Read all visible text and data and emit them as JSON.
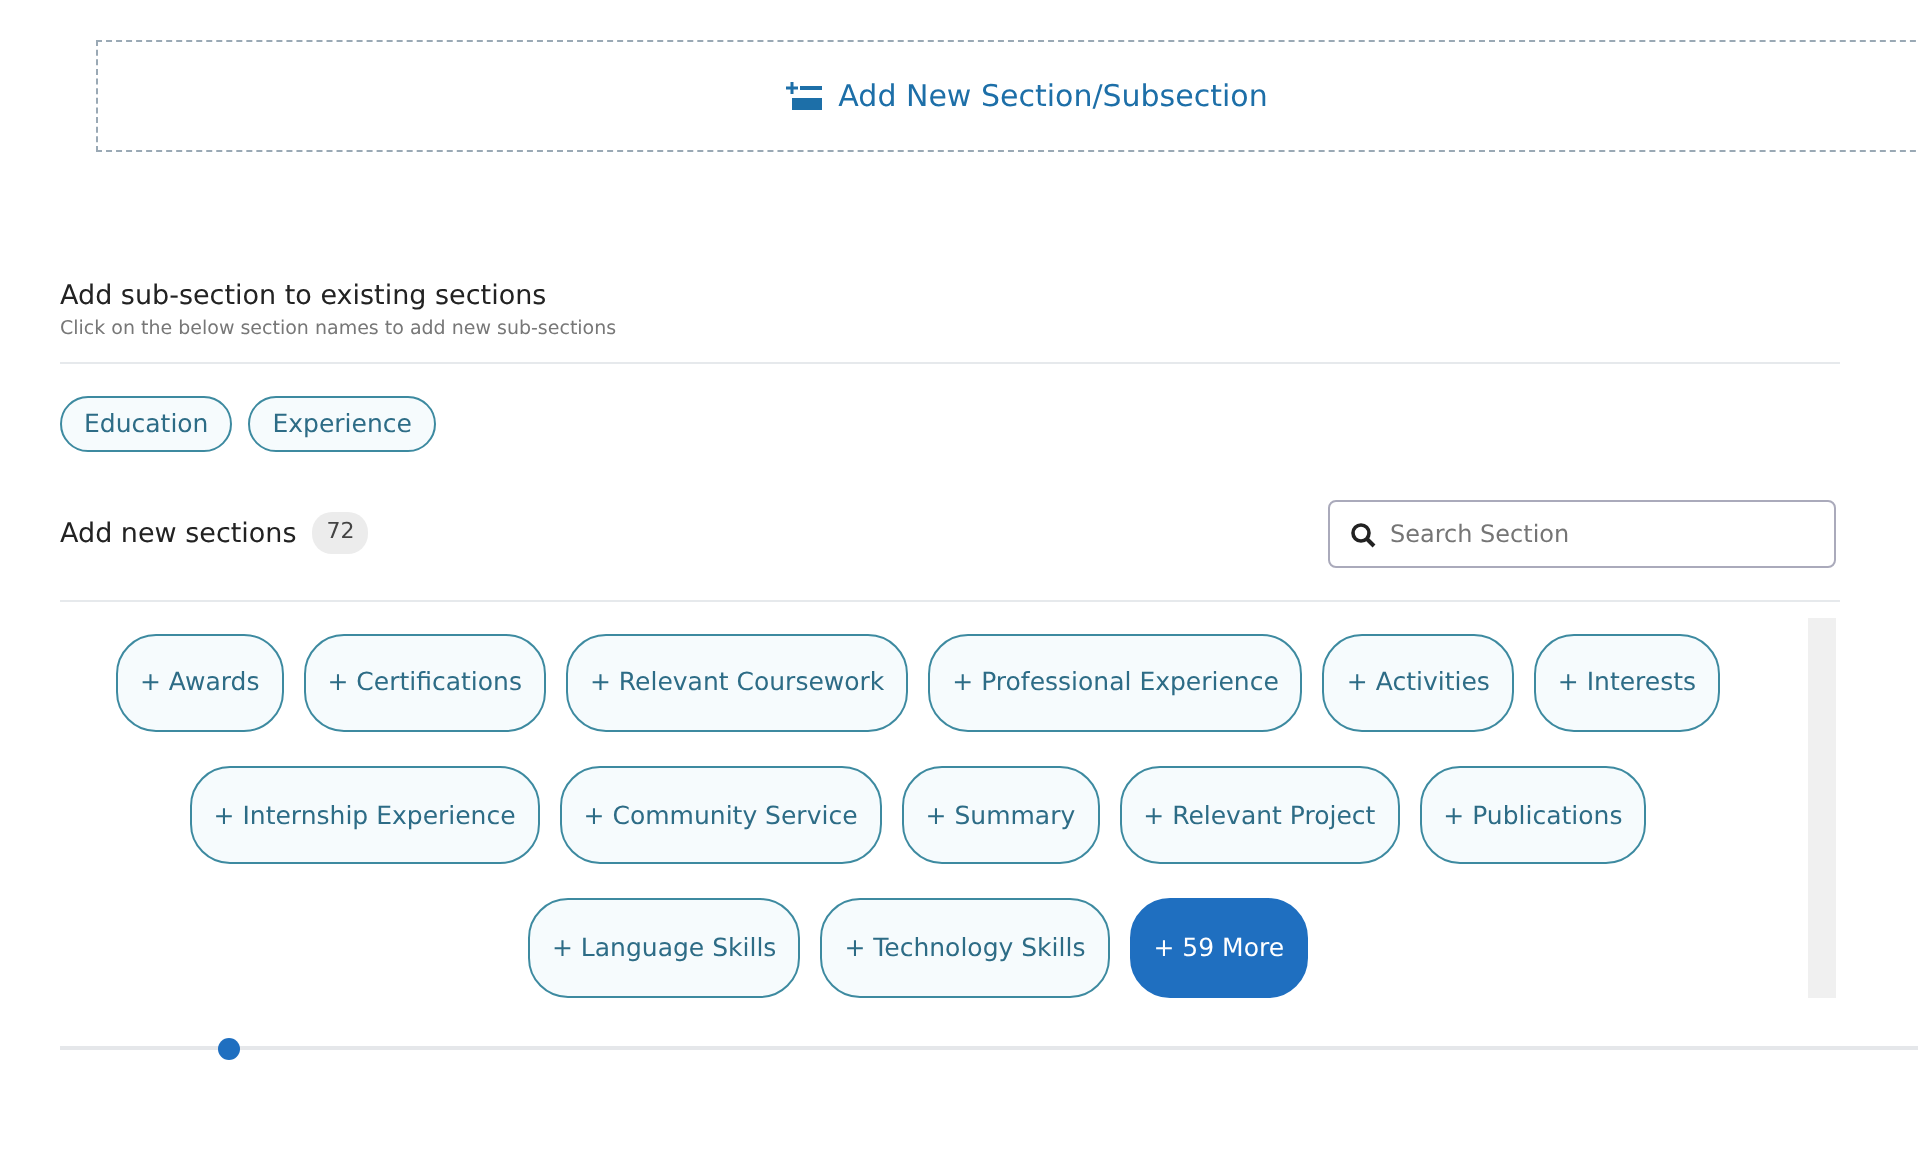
{
  "add_button": {
    "label": "Add New Section/Subsection"
  },
  "existing": {
    "title": "Add sub-section to existing sections",
    "subtitle": "Click on the below section names to add new sub-sections",
    "sections": [
      "Education",
      "Experience"
    ]
  },
  "new_sections": {
    "title": "Add new sections",
    "count": "72",
    "search": {
      "placeholder": "Search Section"
    },
    "items": [
      {
        "kind": "chip",
        "label": "+ Awards"
      },
      {
        "kind": "chip",
        "label": "+ Certifications"
      },
      {
        "kind": "chip",
        "label": "+ Relevant Coursework"
      },
      {
        "kind": "chip",
        "label": "+ Professional Experience"
      },
      {
        "kind": "chip",
        "label": "+ Activities"
      },
      {
        "kind": "chip",
        "label": "+ Interests"
      },
      {
        "kind": "chip",
        "label": "+ Internship Experience"
      },
      {
        "kind": "chip",
        "label": "+ Community Service"
      },
      {
        "kind": "chip",
        "label": "+ Summary"
      },
      {
        "kind": "chip",
        "label": "+ Relevant Project"
      },
      {
        "kind": "chip",
        "label": "+ Publications"
      },
      {
        "kind": "chip",
        "label": "+ Language Skills"
      },
      {
        "kind": "chip",
        "label": "+ Technology Skills"
      },
      {
        "kind": "more",
        "label": "+ 59 More"
      }
    ]
  },
  "slider": {
    "level": 0.09
  }
}
